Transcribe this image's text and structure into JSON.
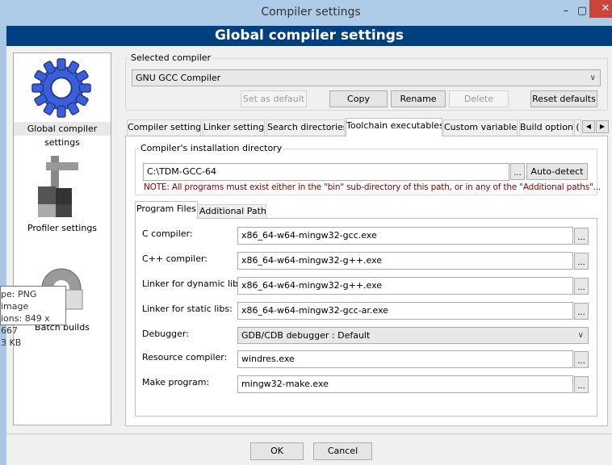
{
  "window": {
    "title": "Compiler settings",
    "minimize_icon": "minimize-icon",
    "maximize_icon": "maximize-icon",
    "close_icon": "close-icon",
    "banner": "Global compiler settings"
  },
  "sidebar": {
    "items": [
      {
        "label": "Global compiler settings",
        "icon": "blue-gear-icon",
        "selected": true
      },
      {
        "label": "Profiler settings",
        "icon": "caliper-icon"
      },
      {
        "label": "Batch builds",
        "icon": "grey-gear-icon"
      }
    ]
  },
  "tooltip": {
    "lines": [
      "pe: PNG image",
      "ions: 849 x 667",
      "3 KB"
    ]
  },
  "selected_compiler": {
    "legend": "Selected compiler",
    "value": "GNU GCC Compiler",
    "buttons": {
      "set_default": "Set as default",
      "copy": "Copy",
      "rename": "Rename",
      "delete": "Delete",
      "reset": "Reset defaults"
    }
  },
  "tabs": [
    "Compiler settings",
    "Linker settings",
    "Search directories",
    "Toolchain executables",
    "Custom variables",
    "Build options",
    "("
  ],
  "active_tab": "Toolchain executables",
  "install_dir": {
    "legend": "Compiler's installation directory",
    "value": "C:\\TDM-GCC-64",
    "browse": "...",
    "autodetect": "Auto-detect",
    "note": "NOTE: All programs must exist either in the \"bin\" sub-directory of this path, or in any of the \"Additional paths\"...",
    "note_color": "#8b0000"
  },
  "inner_tabs": [
    "Program Files",
    "Additional Paths"
  ],
  "programs": [
    {
      "label": "C compiler:",
      "value": "x86_64-w64-mingw32-gcc.exe"
    },
    {
      "label": "C++ compiler:",
      "value": "x86_64-w64-mingw32-g++.exe"
    },
    {
      "label": "Linker for dynamic libs:",
      "value": "x86_64-w64-mingw32-g++.exe"
    },
    {
      "label": "Linker for static libs:",
      "value": "x86_64-w64-mingw32-gcc-ar.exe"
    },
    {
      "label": "Debugger:",
      "value": "GDB/CDB debugger : Default"
    },
    {
      "label": "Resource compiler:",
      "value": "windres.exe"
    },
    {
      "label": "Make program:",
      "value": "mingw32-make.exe"
    }
  ],
  "browse_label": "...",
  "footer": {
    "ok": "OK",
    "cancel": "Cancel"
  }
}
